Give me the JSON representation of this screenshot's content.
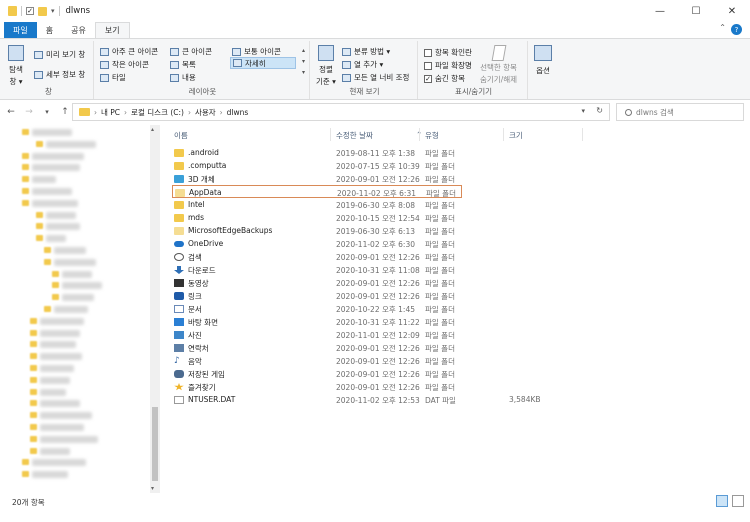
{
  "window": {
    "title": "dlwns",
    "minimize": "—",
    "maximize": "☐",
    "close": "✕"
  },
  "tabs": [
    {
      "label": "파일"
    },
    {
      "label": "홈"
    },
    {
      "label": "공유"
    },
    {
      "label": "보기"
    }
  ],
  "ribbon": {
    "pane": {
      "nav_pane_line1": "탐색",
      "nav_pane_line2": "창 ▾",
      "preview": "미리 보기 창",
      "details": "세부 정보 창",
      "label": "창"
    },
    "layout": {
      "extra_large": "아주 큰 아이콘",
      "large": "큰 아이콘",
      "medium": "보통 아이콘",
      "small": "작은 아이콘",
      "list": "목록",
      "details": "자세히",
      "tiles": "타일",
      "content": "내용",
      "label": "레이아웃"
    },
    "current_view": {
      "sort_line1": "정렬",
      "sort_line2": "기준 ▾",
      "group_by": "분류 방법 ▾",
      "add_columns": "열 추가 ▾",
      "size_all": "모든 열 너비 조정",
      "label": "현재 보기"
    },
    "show_hide": {
      "item_checkboxes": "항목 확인란",
      "extensions": "파일 확장명",
      "hidden_items": "숨긴 항목",
      "hide_selected_line1": "선택한 항목",
      "hide_selected_line2": "숨기기/해제",
      "label": "표시/숨기기"
    },
    "options": {
      "label": "옵션"
    }
  },
  "address": {
    "path": [
      "내 PC",
      "로컬 디스크 (C:)",
      "사용자",
      "dlwns"
    ],
    "separator": "›"
  },
  "search": {
    "placeholder": "dlwns 검색"
  },
  "columns": {
    "name": "이름",
    "date": "수정한 날짜",
    "type": "유형",
    "size": "크기"
  },
  "files": [
    {
      "name": ".android",
      "date": "2019-08-11 오후 1:38",
      "type": "파일 폴더",
      "size": "",
      "icon": "folder"
    },
    {
      "name": ".computta",
      "date": "2020-07-15 오후 10:39",
      "type": "파일 폴더",
      "size": "",
      "icon": "folder"
    },
    {
      "name": "3D 개체",
      "date": "2020-09-01 오전 12:26",
      "type": "파일 폴더",
      "size": "",
      "icon": "cube"
    },
    {
      "name": "AppData",
      "date": "2020-11-02 오후 6:31",
      "type": "파일 폴더",
      "size": "",
      "icon": "folder-pale"
    },
    {
      "name": "Intel",
      "date": "2019-06-30 오후 8:08",
      "type": "파일 폴더",
      "size": "",
      "icon": "folder"
    },
    {
      "name": "mds",
      "date": "2020-10-15 오전 12:54",
      "type": "파일 폴더",
      "size": "",
      "icon": "folder"
    },
    {
      "name": "MicrosoftEdgeBackups",
      "date": "2019-06-30 오후 6:13",
      "type": "파일 폴더",
      "size": "",
      "icon": "folder-pale"
    },
    {
      "name": "OneDrive",
      "date": "2020-11-02 오후 6:30",
      "type": "파일 폴더",
      "size": "",
      "icon": "cloud"
    },
    {
      "name": "검색",
      "date": "2020-09-01 오전 12:26",
      "type": "파일 폴더",
      "size": "",
      "icon": "search"
    },
    {
      "name": "다운로드",
      "date": "2020-10-31 오후 11:08",
      "type": "파일 폴더",
      "size": "",
      "icon": "down"
    },
    {
      "name": "동영상",
      "date": "2020-09-01 오전 12:26",
      "type": "파일 폴더",
      "size": "",
      "icon": "video"
    },
    {
      "name": "링크",
      "date": "2020-09-01 오전 12:26",
      "type": "파일 폴더",
      "size": "",
      "icon": "link"
    },
    {
      "name": "문서",
      "date": "2020-10-22 오후 1:45",
      "type": "파일 폴더",
      "size": "",
      "icon": "doc"
    },
    {
      "name": "바탕 화면",
      "date": "2020-10-31 오후 11:22",
      "type": "파일 폴더",
      "size": "",
      "icon": "desktop"
    },
    {
      "name": "사진",
      "date": "2020-11-01 오전 12:09",
      "type": "파일 폴더",
      "size": "",
      "icon": "picture"
    },
    {
      "name": "연락처",
      "date": "2020-09-01 오전 12:26",
      "type": "파일 폴더",
      "size": "",
      "icon": "contacts"
    },
    {
      "name": "음악",
      "date": "2020-09-01 오전 12:26",
      "type": "파일 폴더",
      "size": "",
      "icon": "music"
    },
    {
      "name": "저장된 게임",
      "date": "2020-09-01 오전 12:26",
      "type": "파일 폴더",
      "size": "",
      "icon": "game"
    },
    {
      "name": "즐겨찾기",
      "date": "2020-09-01 오전 12:26",
      "type": "파일 폴더",
      "size": "",
      "icon": "star"
    },
    {
      "name": "NTUSER.DAT",
      "date": "2020-11-02 오후 12:53",
      "type": "DAT 파일",
      "size": "3,584KB",
      "icon": "file"
    }
  ],
  "highlighted_row": "AppData",
  "status": {
    "count": "20개 항목"
  }
}
